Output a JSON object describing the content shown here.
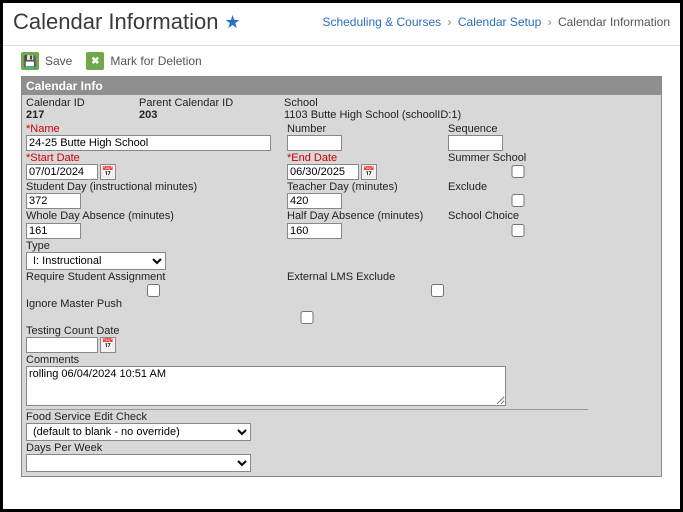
{
  "header": {
    "title": "Calendar Information",
    "breadcrumb": [
      {
        "label": "Scheduling & Courses",
        "link": true
      },
      {
        "label": "Calendar Setup",
        "link": true
      },
      {
        "label": "Calendar Information",
        "link": false
      }
    ]
  },
  "toolbar": {
    "save_label": "Save",
    "delete_label": "Mark for Deletion"
  },
  "panel": {
    "title": "Calendar Info",
    "calendar_id_label": "Calendar ID",
    "calendar_id": "217",
    "parent_id_label": "Parent Calendar ID",
    "parent_id": "203",
    "school_label": "School",
    "school": "1103 Butte High School (schoolID:1)",
    "name_label": "*Name",
    "name": "24-25 Butte High School",
    "number_label": "Number",
    "number": "",
    "sequence_label": "Sequence",
    "sequence": "",
    "start_date_label": "*Start Date",
    "start_date": "07/01/2024",
    "end_date_label": "*End Date",
    "end_date": "06/30/2025",
    "summer_label": "Summer School",
    "student_day_label": "Student Day (instructional minutes)",
    "student_day": "372",
    "teacher_day_label": "Teacher Day (minutes)",
    "teacher_day": "420",
    "exclude_label": "Exclude",
    "whole_day_label": "Whole Day Absence (minutes)",
    "whole_day": "161",
    "half_day_label": "Half Day Absence (minutes)",
    "half_day": "160",
    "school_choice_label": "School Choice",
    "type_label": "Type",
    "type": "I: Instructional",
    "require_assign_label": "Require Student Assignment",
    "ext_lms_label": "External LMS Exclude",
    "ignore_master_label": "Ignore Master Push",
    "test_count_label": "Testing Count Date",
    "test_count": "",
    "comments_label": "Comments",
    "comments": "rolling 06/04/2024 10:51 AM",
    "food_service_label": "Food Service Edit Check",
    "food_service": "(default to blank - no override)",
    "days_per_week_label": "Days Per Week",
    "days_per_week": ""
  }
}
